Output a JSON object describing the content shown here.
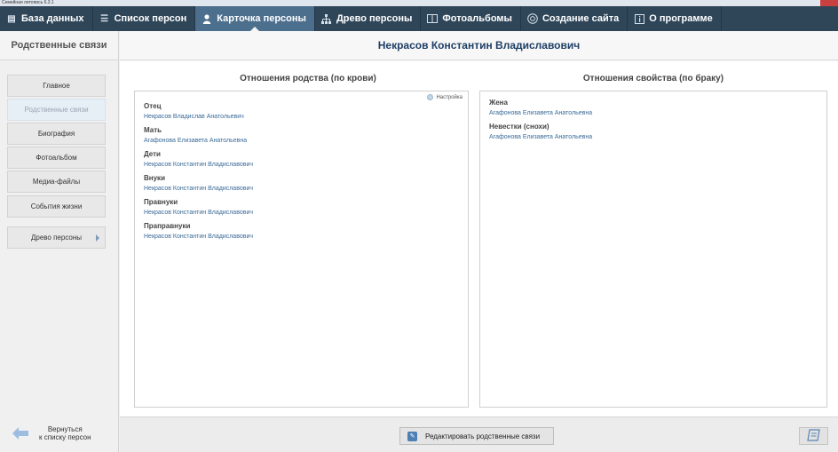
{
  "window": {
    "title": "Семейная летопись 6.3.1"
  },
  "menu": [
    {
      "label": "База данных",
      "icon": "menu-icon",
      "glyph": "▤"
    },
    {
      "label": "Список персон",
      "icon": "list-icon",
      "glyph": "☰"
    },
    {
      "label": "Карточка персоны",
      "icon": "person-icon",
      "glyph": "👤",
      "active": true
    },
    {
      "label": "Древо персоны",
      "icon": "tree-icon",
      "glyph": "⋔"
    },
    {
      "label": "Фотоальбомы",
      "icon": "photo-album-icon",
      "glyph": "▭"
    },
    {
      "label": "Создание сайта",
      "icon": "globe-icon",
      "glyph": "◎"
    },
    {
      "label": "О программе",
      "icon": "info-icon",
      "glyph": "ⓘ"
    }
  ],
  "sidebar": {
    "heading": "Родственные связи",
    "buttons": [
      {
        "label": "Главное"
      },
      {
        "label": "Родственные связи",
        "selected": true
      },
      {
        "label": "Биография"
      },
      {
        "label": "Фотоальбом"
      },
      {
        "label": "Медиа-файлы"
      },
      {
        "label": "События жизни"
      },
      {
        "label": "Древо персоны",
        "has_arrow": true
      }
    ],
    "back": {
      "line1": "Вернуться",
      "line2": "к списку персон"
    }
  },
  "person": {
    "name": "Некрасов Константин Владиславович"
  },
  "blood": {
    "title": "Отношения родства (по крови)",
    "setting_label": "Настройка",
    "relations": [
      {
        "label": "Отец",
        "person": "Некрасов Владислав Анатольевич"
      },
      {
        "label": "Мать",
        "person": "Агафонова Елизавета Анатольевна"
      },
      {
        "label": "Дети",
        "person": "Некрасов Константин Владиславович"
      },
      {
        "label": "Внуки",
        "person": "Некрасов Константин Владиславович"
      },
      {
        "label": "Правнуки",
        "person": "Некрасов Константин Владиславович"
      },
      {
        "label": "Праправнуки",
        "person": "Некрасов Константин Владиславович"
      }
    ]
  },
  "marriage": {
    "title": "Отношения свойства (по браку)",
    "relations": [
      {
        "label": "Жена",
        "person": "Агафонова Елизавета Анатольевна"
      },
      {
        "label": "Невестки (снохи)",
        "person": "Агафонова Елизавета Анатольевна"
      }
    ]
  },
  "footer": {
    "edit_label": "Редактировать родственные связи"
  },
  "colors": {
    "menubar": "#2f4659",
    "active_tab": "#4d6f8e",
    "link": "#3a6b99",
    "title": "#1f3f66"
  }
}
